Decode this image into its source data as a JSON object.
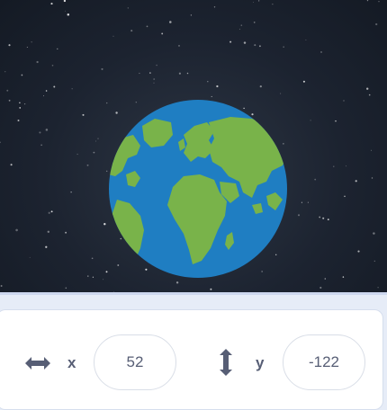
{
  "sprite_info": {
    "x_label": "x",
    "x_value": "52",
    "y_label": "y",
    "y_value": "-122"
  },
  "icons": {
    "x_arrow": "horizontal-double-arrow-icon",
    "y_arrow": "vertical-double-arrow-icon"
  },
  "colors": {
    "ocean": "#1f7ec2",
    "land": "#79b34a",
    "label_text": "#575e75",
    "space": "#1c2330"
  }
}
